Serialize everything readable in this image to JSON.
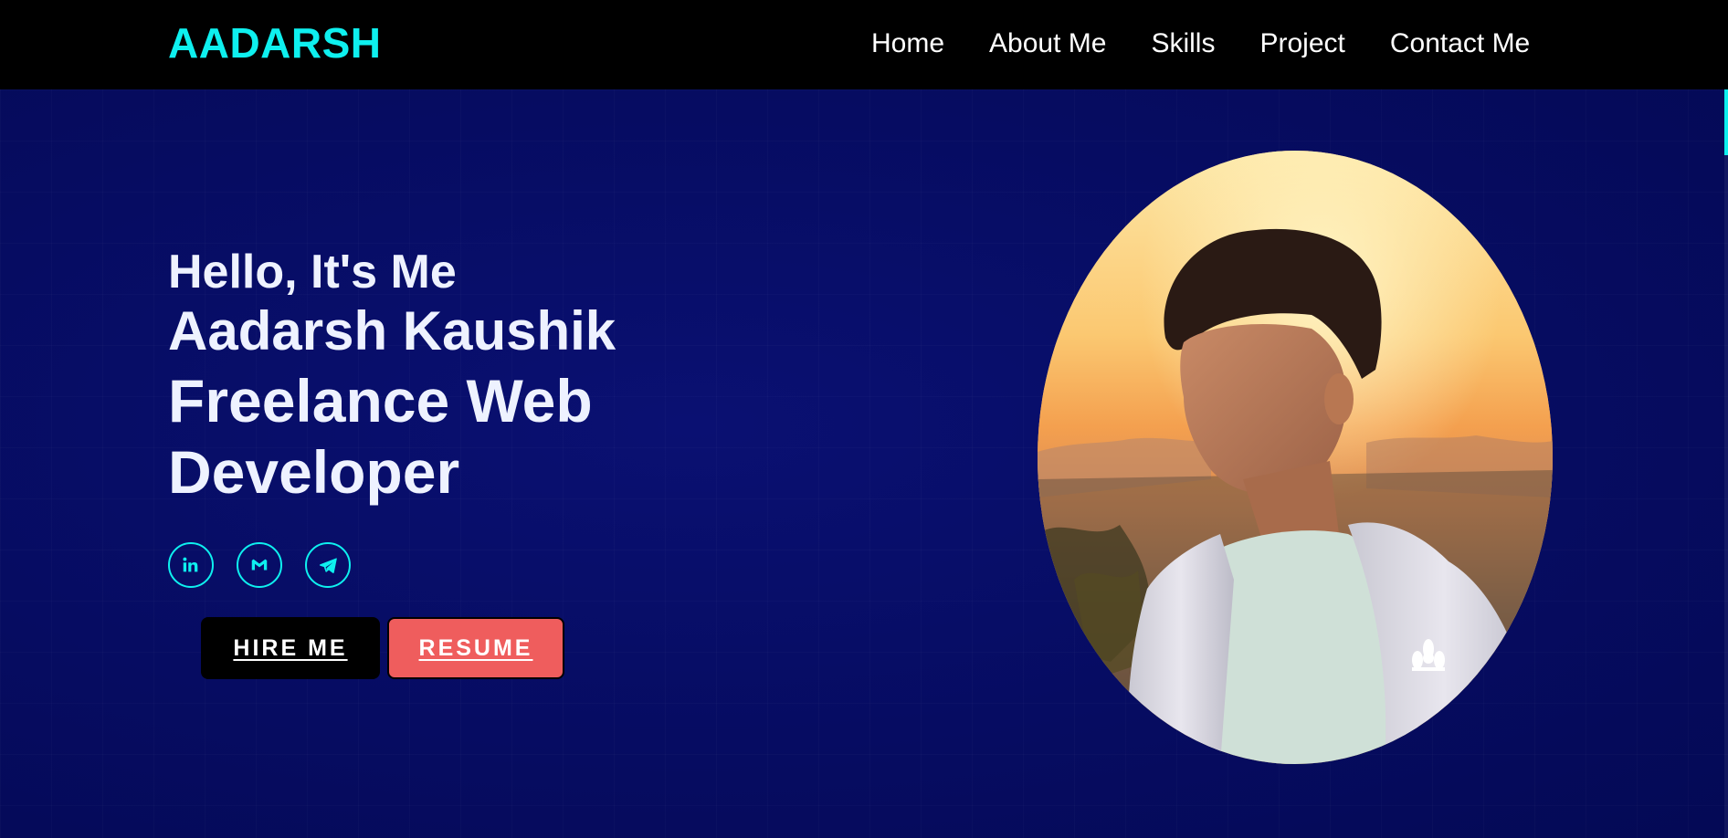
{
  "brand": {
    "logo": "AADARSH",
    "accent_color": "#0ef0ef"
  },
  "nav": {
    "items": [
      {
        "label": "Home"
      },
      {
        "label": "About Me"
      },
      {
        "label": "Skills"
      },
      {
        "label": "Project"
      },
      {
        "label": "Contact Me"
      }
    ]
  },
  "hero": {
    "greeting": "Hello, It's Me",
    "name": "Aadarsh Kaushik",
    "role": "Freelance Web Developer",
    "background_color": "#050a5c",
    "socials": [
      {
        "icon": "linkedin-icon"
      },
      {
        "icon": "gmail-icon"
      },
      {
        "icon": "telegram-icon"
      }
    ],
    "buttons": {
      "hire_label": "HIRE ME",
      "resume_label": "RESUME",
      "resume_color": "#ef5d5d"
    },
    "portrait": {
      "icon": "profile-photo"
    }
  }
}
